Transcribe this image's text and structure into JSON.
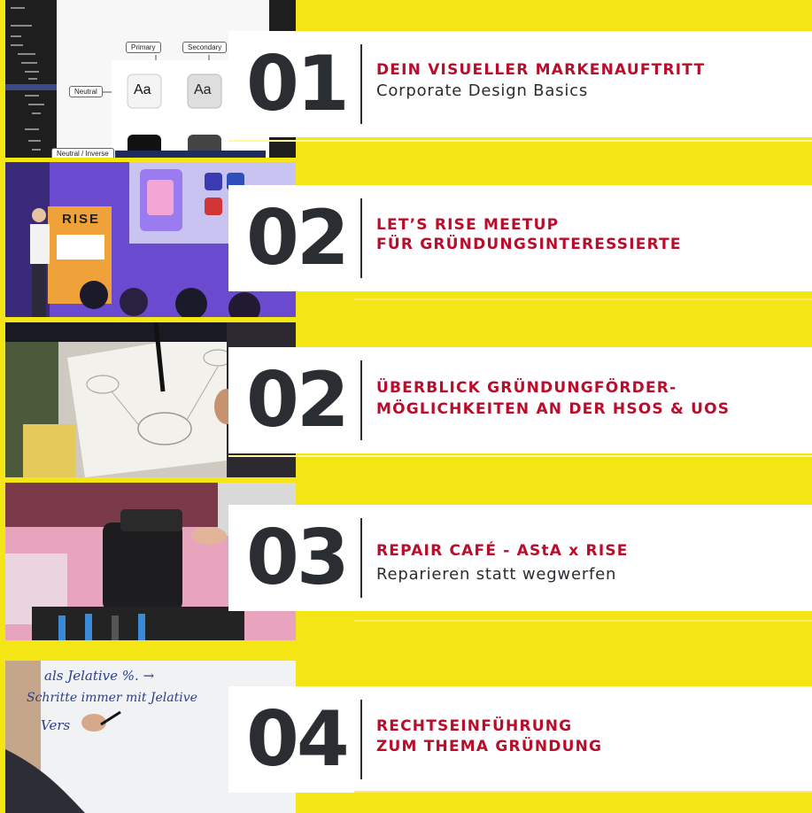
{
  "items": [
    {
      "number": "01",
      "title": "DEIN VISUELLER MARKENAUFTRITT",
      "subtitle": "Corporate Design Basics"
    },
    {
      "number": "02",
      "title": "LET’S RISE MEETUP",
      "title2": "FÜR GRÜNDUNGSINTERESSIERTE"
    },
    {
      "number": "02",
      "title": "ÜBERBLICK GRÜNDUNGFÖRDER-",
      "title2": "MÖGLICHKEITEN AN DER HSOS & UOS"
    },
    {
      "number": "03",
      "title": "REPAIR CAFÉ - AStA x RISE",
      "subtitle": "Reparieren statt wegwerfen"
    },
    {
      "number": "04",
      "title": "RECHTSEINFÜHRUNG",
      "title2": "ZUM THEMA GRÜNDUNG"
    }
  ],
  "screenshot_ui": {
    "primary_label": "Primary",
    "secondary_label": "Secondary",
    "neutral_label": "Neutral",
    "inverse_label": "Neutral / Inverse",
    "swatch_text": "Aa"
  },
  "meetup_sign": "RISE",
  "whiteboard_lines": [
    "als Jelative %. →",
    "Schritte immer mit Jelative",
    "Vers"
  ],
  "colors": {
    "background": "#f3e614",
    "card": "#ffffff",
    "title": "#b80d2b",
    "number": "#2a2d31"
  }
}
